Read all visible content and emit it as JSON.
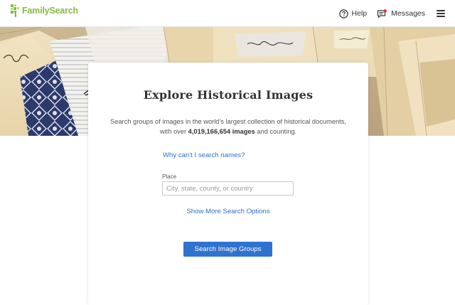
{
  "header": {
    "logo_text": "FamilySearch",
    "help_label": "Help",
    "messages_label": "Messages"
  },
  "icons": {
    "logo": "familysearch-tree-icon",
    "help": "question-circle-icon",
    "messages": "message-icon",
    "menu": "hamburger-menu-icon"
  },
  "colors": {
    "brand_green": "#87b940",
    "link_blue": "#2f6fc6",
    "button_blue": "#2f73d0",
    "notification_red": "#d9342b"
  },
  "hero": {
    "folder_tabs": [
      "mvres",
      "Rowland",
      "Harbaugh"
    ]
  },
  "card": {
    "title": "Explore Historical Images",
    "description_before": "Search groups of images in the world's largest collection of historical documents, with over ",
    "description_bold": "4,019,166,654 images",
    "description_after": " and counting.",
    "why_link": "Why can't I search names?",
    "place_label": "Place",
    "place_placeholder": "City, state, county, or country",
    "place_value": "",
    "more_options_link": "Show More Search Options",
    "search_button": "Search Image Groups"
  }
}
